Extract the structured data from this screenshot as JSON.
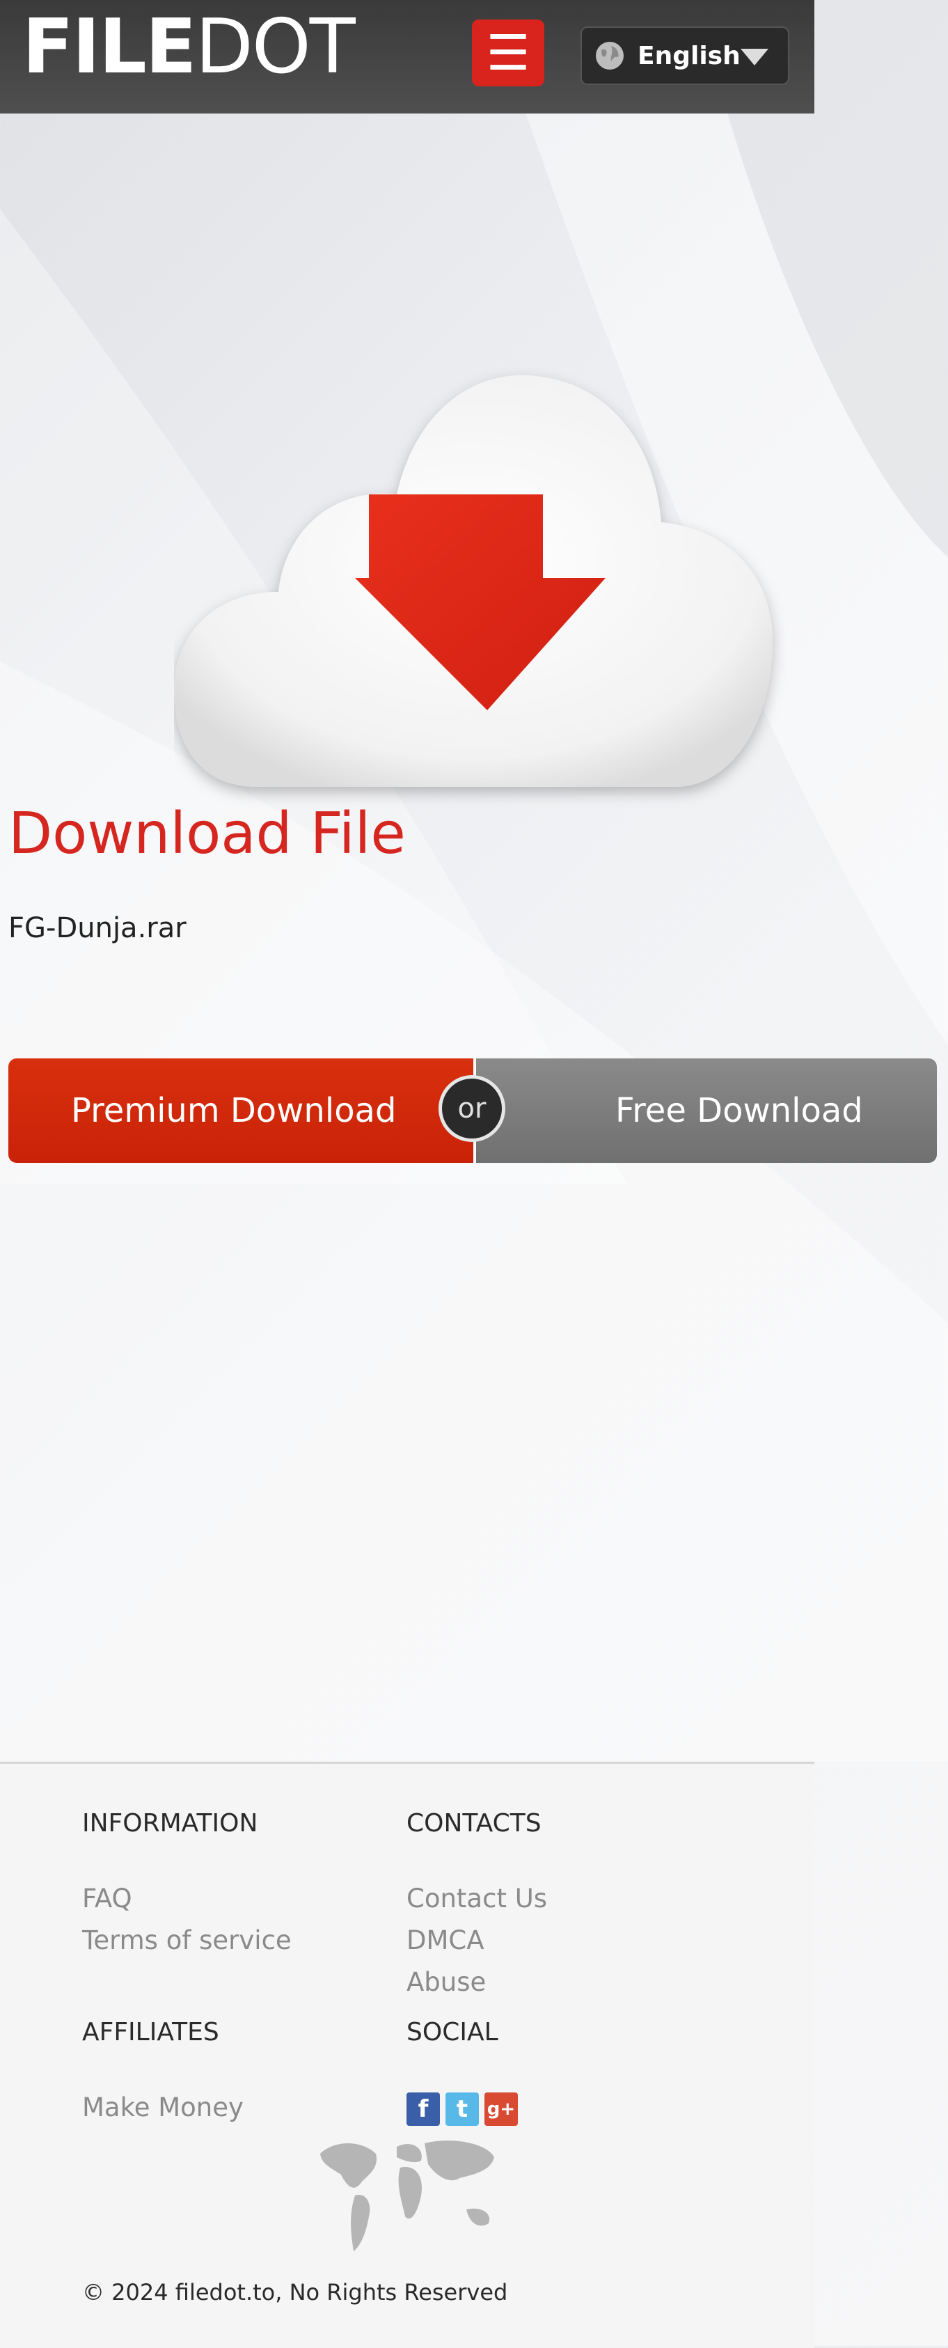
{
  "header": {
    "logo_bold": "FILE",
    "logo_light": "DOT",
    "menu_glyph": "☰",
    "language": "English"
  },
  "hero": {
    "title": "Download File",
    "filename": "FG-Dunja.rar"
  },
  "download": {
    "premium_label": "Premium Download",
    "or_label": "or",
    "free_label": "Free Download"
  },
  "footer": {
    "information": {
      "heading": "INFORMATION",
      "links": [
        "FAQ",
        "Terms of service"
      ]
    },
    "contacts": {
      "heading": "CONTACTS",
      "links": [
        "Contact Us",
        "DMCA",
        "Abuse"
      ]
    },
    "affiliates": {
      "heading": "AFFILIATES",
      "links": [
        "Make Money"
      ]
    },
    "social": {
      "heading": "SOCIAL",
      "facebook_glyph": "f",
      "twitter_glyph": "t",
      "google_glyph": "g+"
    },
    "copyright": "© 2024 filedot.to, No Rights Reserved"
  },
  "colors": {
    "brand_red": "#d52620",
    "header_bg": "#454545",
    "free_gray": "#7d7d7d"
  },
  "icons": [
    "menu-icon",
    "globe-icon",
    "caret-down-icon",
    "cloud-download-icon",
    "facebook-icon",
    "twitter-icon",
    "google-plus-icon",
    "world-map-icon"
  ]
}
